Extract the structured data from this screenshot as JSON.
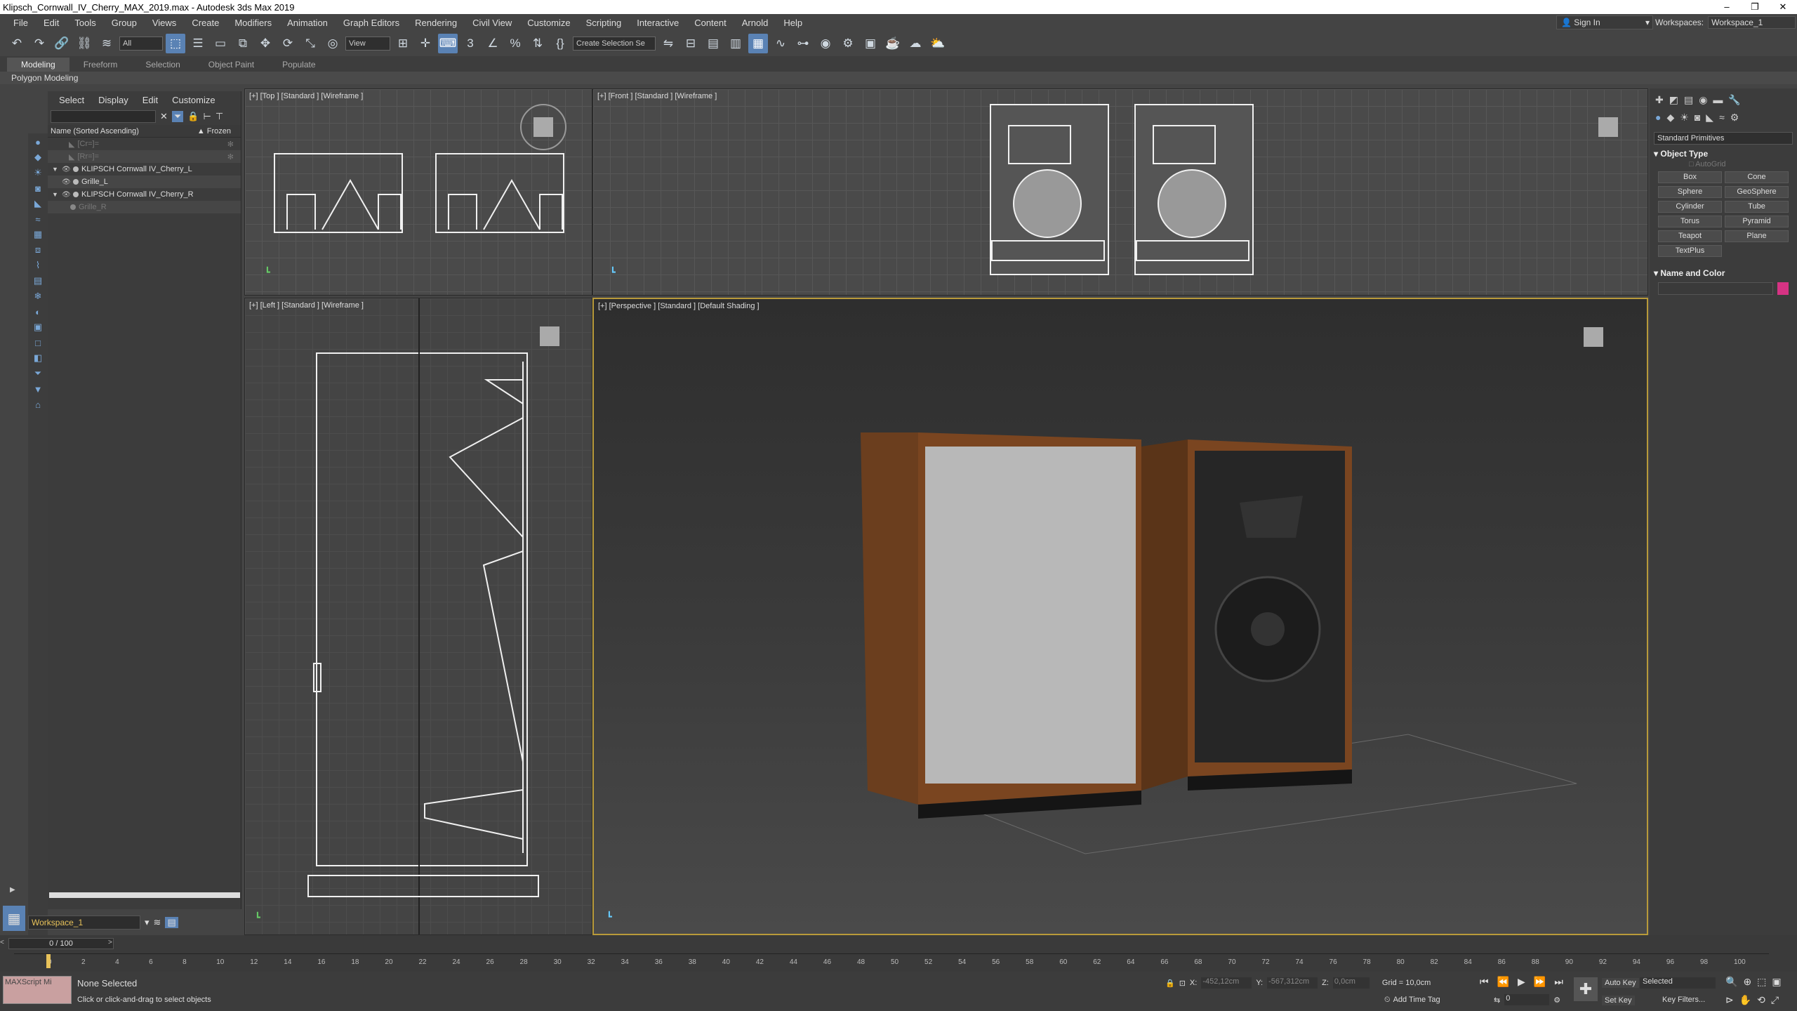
{
  "window": {
    "title": "Klipsch_Cornwall_IV_Cherry_MAX_2019.max - Autodesk 3ds Max 2019"
  },
  "menu": [
    "File",
    "Edit",
    "Tools",
    "Group",
    "Views",
    "Create",
    "Modifiers",
    "Animation",
    "Graph Editors",
    "Rendering",
    "Civil View",
    "Customize",
    "Scripting",
    "Interactive",
    "Content",
    "Arnold",
    "Help"
  ],
  "account": {
    "sign_in": "Sign In",
    "workspaces_label": "Workspaces:",
    "workspace_value": "Workspace_1"
  },
  "toolbar": {
    "filter_value": "All",
    "ref_coord": "View",
    "selection_set": "Create Selection Se"
  },
  "ribbon": {
    "tabs": [
      "Modeling",
      "Freeform",
      "Selection",
      "Object Paint",
      "Populate"
    ],
    "panel": "Polygon Modeling"
  },
  "scene_explorer": {
    "tabs": [
      "Select",
      "Display",
      "Edit",
      "Customize"
    ],
    "column_name": "Name (Sorted Ascending)",
    "column_frozen": "▲ Frozen",
    "rows": [
      {
        "name": "[Cr=]="
      },
      {
        "name": "[Rr=]="
      },
      {
        "name": "KLIPSCH Cornwall IV_Cherry_L"
      },
      {
        "name": "Grille_L"
      },
      {
        "name": "KLIPSCH Cornwall IV_Cherry_R"
      },
      {
        "name": "Grille_R"
      }
    ],
    "workspace": "Workspace_1"
  },
  "viewports": {
    "top": "[+] [Top ] [Standard ] [Wireframe ]",
    "front": "[+] [Front ] [Standard ] [Wireframe ]",
    "left": "[+] [Left ] [Standard ] [Wireframe ]",
    "perspective": "[+] [Perspective ] [Standard ] [Default Shading ]"
  },
  "command_panel": {
    "category": "Standard Primitives",
    "object_type_title": "Object Type",
    "autogrid": "AutoGrid",
    "buttons": [
      "Box",
      "Cone",
      "Sphere",
      "GeoSphere",
      "Cylinder",
      "Tube",
      "Torus",
      "Pyramid",
      "Teapot",
      "Plane",
      "TextPlus"
    ],
    "name_color_title": "Name and Color",
    "object_color": "#d63384"
  },
  "timeline": {
    "frame": "0 / 100",
    "ticks": [
      "0",
      "2",
      "4",
      "6",
      "8",
      "10",
      "12",
      "14",
      "16",
      "18",
      "20",
      "22",
      "24",
      "26",
      "28",
      "30",
      "32",
      "34",
      "36",
      "38",
      "40",
      "42",
      "44",
      "46",
      "48",
      "50",
      "52",
      "54",
      "56",
      "58",
      "60",
      "62",
      "64",
      "66",
      "68",
      "70",
      "72",
      "74",
      "76",
      "78",
      "80",
      "82",
      "84",
      "86",
      "88",
      "90",
      "92",
      "94",
      "96",
      "98",
      "100"
    ]
  },
  "status": {
    "maxscript": "MAXScript Mi",
    "selection": "None Selected",
    "prompt": "Click or click-and-drag to select objects",
    "x": "-452,12cm",
    "y": "-567,312cm",
    "z": "0,0cm",
    "grid": "Grid = 10,0cm",
    "add_time_tag": "Add Time Tag",
    "auto_key": "Auto Key",
    "set_key": "Set Key",
    "selected": "Selected",
    "key_filters": "Key Filters...",
    "frame_value": "0"
  }
}
